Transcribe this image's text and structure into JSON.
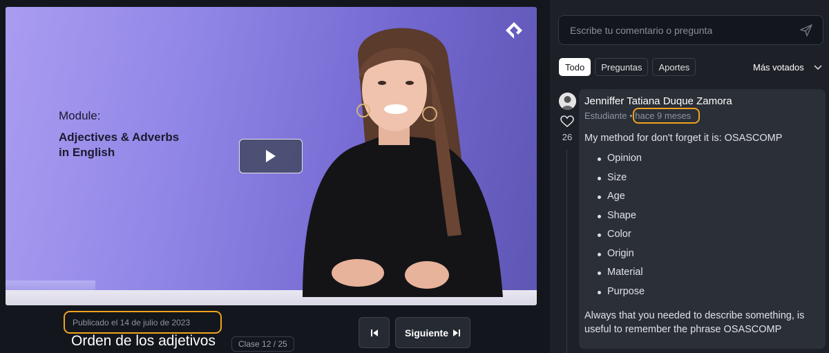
{
  "video": {
    "module_kicker": "Module:",
    "module_title": "Adjectives & Adverbs\nin English"
  },
  "lesson": {
    "published": "Publicado el 14 de julio de 2023",
    "title": "Orden de los adjetivos",
    "class_badge": "Clase 12 / 25",
    "next_label": "Siguiente"
  },
  "comments": {
    "placeholder": "Escribe tu comentario o pregunta",
    "filters": [
      "Todo",
      "Preguntas",
      "Aportes"
    ],
    "active_filter": "Todo",
    "sort_label": "Más votados",
    "item": {
      "author": "Jenniffer Tatiana Duque Zamora",
      "role": "Estudiante",
      "separator": "•",
      "time": "hace 9 meses",
      "likes": "26",
      "intro": "My method for don't forget it is: OSASCOMP",
      "list": [
        "Opinion",
        "Size",
        "Age",
        "Shape",
        "Color",
        "Origin",
        "Material",
        "Purpose"
      ],
      "closing": "Always that you needed to describe something, is useful to remember the phrase OSASCOMP"
    }
  },
  "colors": {
    "highlight": "#f0a41e",
    "background": "#13161c",
    "panel": "#1d2027",
    "card": "#2b2f37"
  },
  "icons": [
    "brand-logo-icon",
    "play-icon",
    "prev-icon",
    "next-icon",
    "send-icon",
    "chevron-down-icon",
    "heart-icon"
  ]
}
